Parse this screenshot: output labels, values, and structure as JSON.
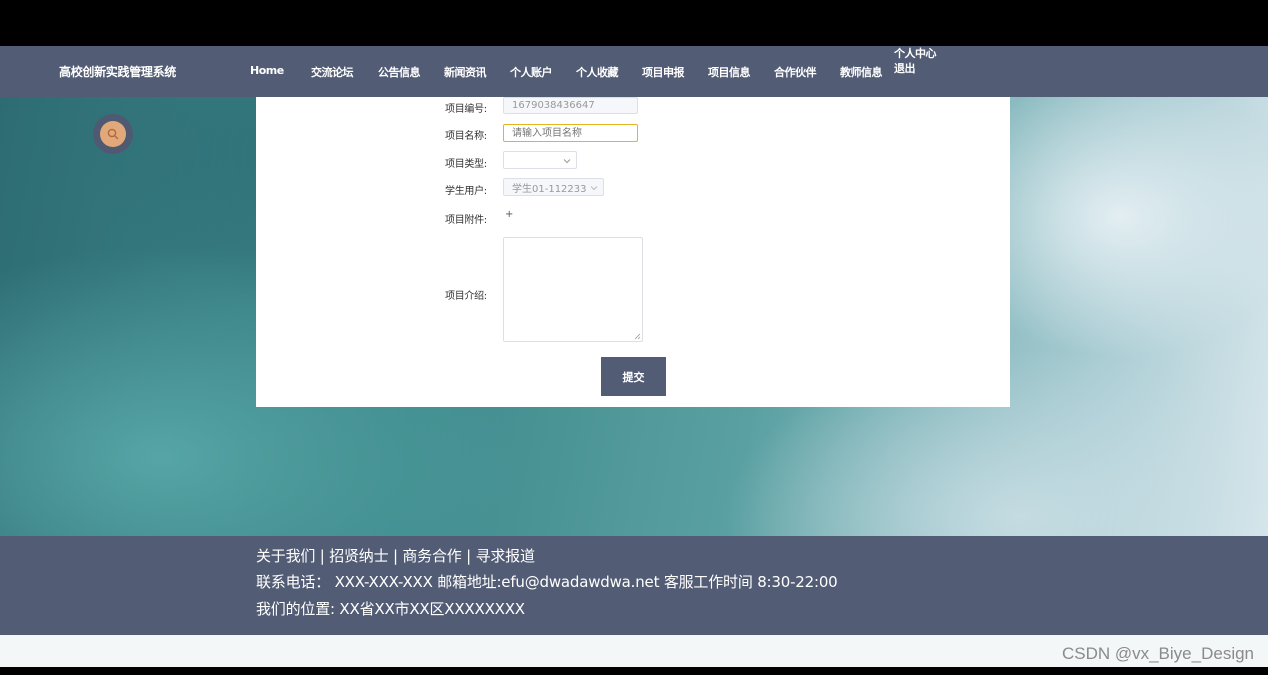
{
  "navbar": {
    "site_title": "高校创新实践管理系统",
    "items": [
      "Home",
      "交流论坛",
      "公告信息",
      "新闻资讯",
      "个人账户",
      "个人收藏",
      "项目申报",
      "项目信息",
      "合作伙伴",
      "教师信息"
    ],
    "user_center": "个人中心",
    "logout": "退出"
  },
  "form": {
    "fields": {
      "project_no": {
        "label": "项目编号:",
        "value": "1679038436647"
      },
      "project_name": {
        "label": "项目名称:",
        "placeholder": "请输入项目名称"
      },
      "project_type": {
        "label": "项目类型:",
        "value": ""
      },
      "student_user": {
        "label": "学生用户:",
        "value": "学生01-112233"
      },
      "attachment": {
        "label": "项目附件:",
        "add_symbol": "+"
      },
      "intro": {
        "label": "项目介绍:"
      }
    },
    "submit_label": "提交"
  },
  "footer": {
    "line1": "关于我们 | 招贤纳士 | 商务合作 | 寻求报道",
    "line2": "联系电话： XXX-XXX-XXX 邮箱地址:efu@dwadawdwa.net 客服工作时间 8:30-22:00",
    "line3": "我们的位置: XX省XX市XX区XXXXXXXX"
  },
  "watermark": "CSDN @vx_Biye_Design",
  "icons": {
    "search": "search-icon",
    "select_arrow": "chevron-down-icon"
  },
  "colors": {
    "primary": "#525c74",
    "focus_border": "#e6b422",
    "search_badge": "#e1a97a"
  }
}
